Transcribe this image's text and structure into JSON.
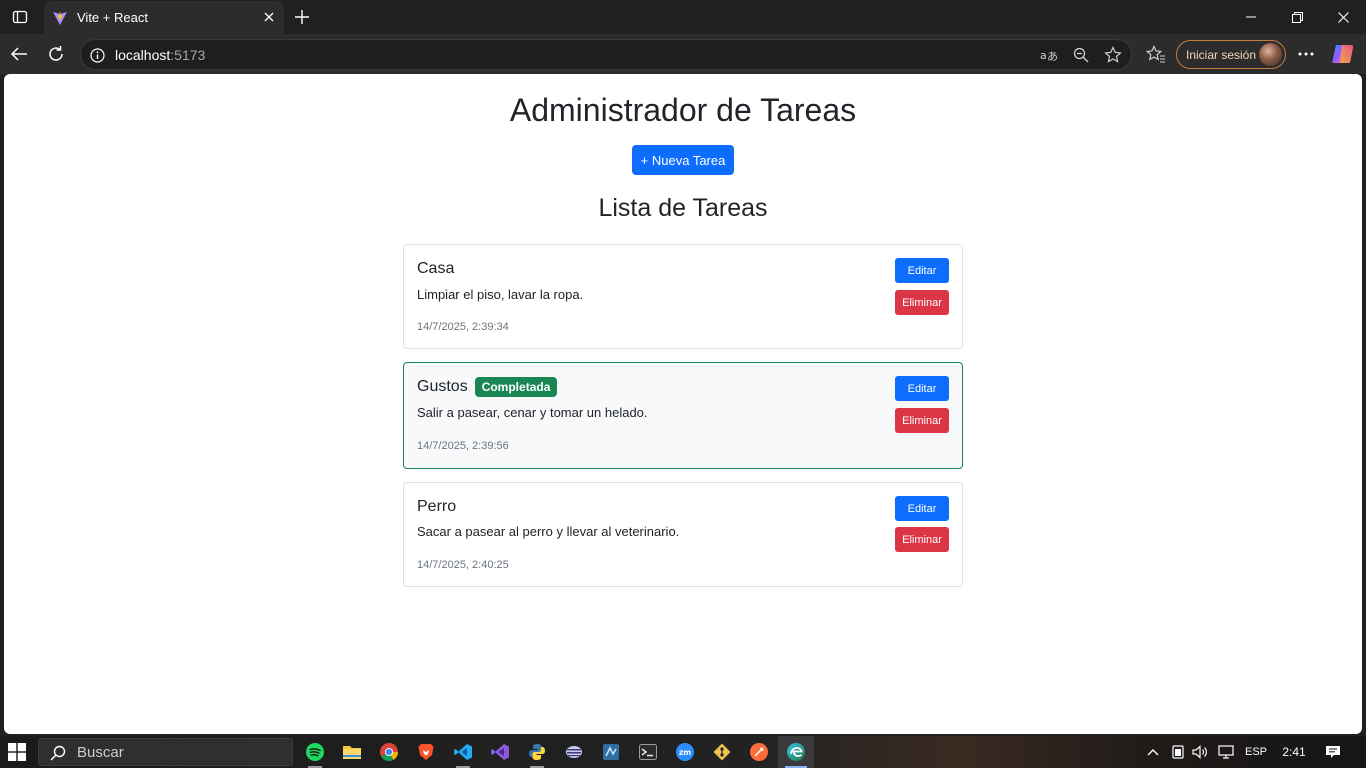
{
  "browser": {
    "tab_title": "Vite + React",
    "url_host": "localhost",
    "url_port": ":5173",
    "signin_label": "Iniciar sesión"
  },
  "page": {
    "title": "Administrador de Tareas",
    "new_task_label": "+ Nueva Tarea",
    "list_title": "Lista de Tareas",
    "edit_label": "Editar",
    "delete_label": "Eliminar"
  },
  "tasks": [
    {
      "name": "Casa",
      "description": "Limpiar el piso, lavar la ropa.",
      "date": "14/7/2025, 2:39:34",
      "completed": false,
      "badge": ""
    },
    {
      "name": "Gustos",
      "description": "Salir a pasear, cenar y tomar un helado.",
      "date": "14/7/2025, 2:39:56",
      "completed": true,
      "badge": "Completada"
    },
    {
      "name": "Perro",
      "description": "Sacar a pasear al perro y llevar al veterinario.",
      "date": "14/7/2025, 2:40:25",
      "completed": false,
      "badge": ""
    }
  ],
  "taskbar": {
    "search_label": "Buscar",
    "apps": [
      "spotify-icon",
      "file-explorer-icon",
      "chrome-icon",
      "brave-icon",
      "vscode-icon",
      "visual-studio-icon",
      "python-icon",
      "app-icon",
      "ssms-icon",
      "terminal-icon",
      "zoom-icon",
      "git-icon",
      "postman-icon",
      "edge-icon"
    ],
    "language": "ESP",
    "time": "2:41"
  },
  "colors": {
    "primary": "#0d6efd",
    "danger": "#dc3545",
    "success": "#198754"
  }
}
